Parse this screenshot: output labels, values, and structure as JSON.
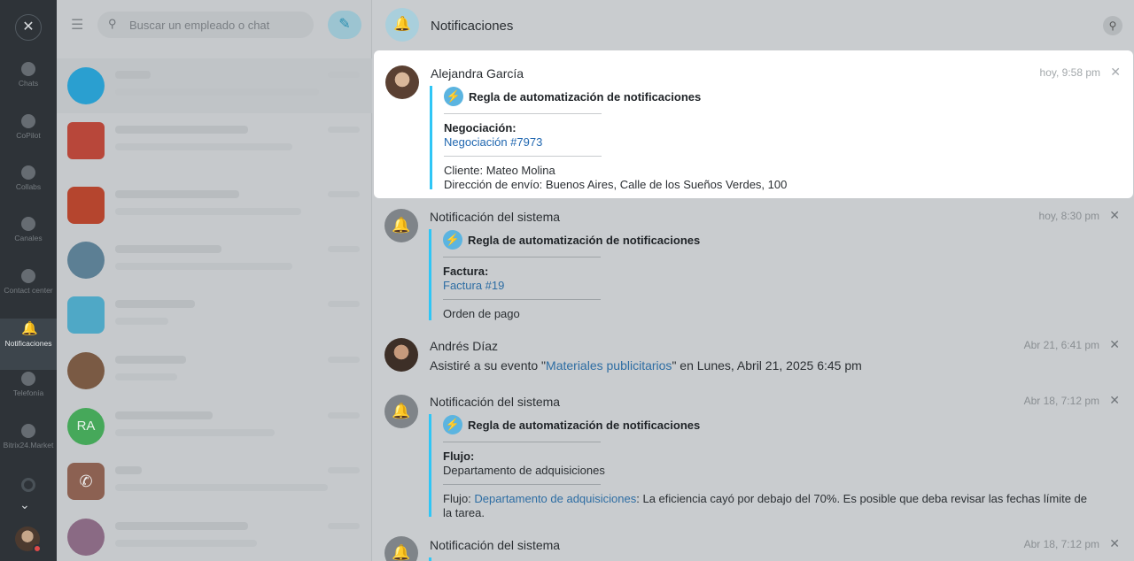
{
  "rail": {
    "items": [
      {
        "label": "Chats"
      },
      {
        "label": "CoPilot"
      },
      {
        "label": "Collabs"
      },
      {
        "label": "Canales"
      },
      {
        "label": "Contact center"
      },
      {
        "label": "Notificaciones"
      },
      {
        "label": "Telefonía"
      },
      {
        "label": "Bitrix24.Market"
      }
    ]
  },
  "chatlist": {
    "search_placeholder": "Buscar un empleado o chat",
    "avatar_ra": "RA"
  },
  "panel": {
    "title": "Notificaciones"
  },
  "notifications": [
    {
      "sender": "Alejandra García",
      "time": "hoy, 9:58 pm",
      "rule": "Regla de automatización de notificaciones",
      "field_label": "Negociación:",
      "field_link": "Negociación #7973",
      "line1": "Cliente: Mateo Molina",
      "line2": "Dirección de envío: Buenos Aires, Calle de los Sueños Verdes, 100"
    },
    {
      "sender": "Notificación del sistema",
      "time": "hoy, 8:30 pm",
      "rule": "Regla de automatización de notificaciones",
      "field_label": "Factura:",
      "field_link": "Factura #19",
      "line1": "Orden de pago"
    },
    {
      "sender": "Andrés Díaz",
      "time": "Abr 21, 6:41 pm",
      "text_before": "Asistiré a su evento \"",
      "event_link": "Materiales publicitarios",
      "text_after": "\" en Lunes, Abril 21, 2025 6:45 pm"
    },
    {
      "sender": "Notificación del sistema",
      "time": "Abr 18, 7:12 pm",
      "rule": "Regla de automatización de notificaciones",
      "field_label": "Flujo:",
      "field_value": "Departamento de adquisiciones",
      "flow_prefix": "Flujo: ",
      "flow_link": "Departamento de adquisiciones",
      "flow_text": ": La eficiencia cayó por debajo del 70%. Es posible que deba revisar las fechas límite de",
      "flow_text2": "la tarea."
    },
    {
      "sender": "Notificación del sistema",
      "time": "Abr 18, 7:12 pm"
    }
  ],
  "colors": {
    "accent": "#2fc6f6",
    "link": "#2067b0",
    "rail_bg": "#2e3338"
  }
}
